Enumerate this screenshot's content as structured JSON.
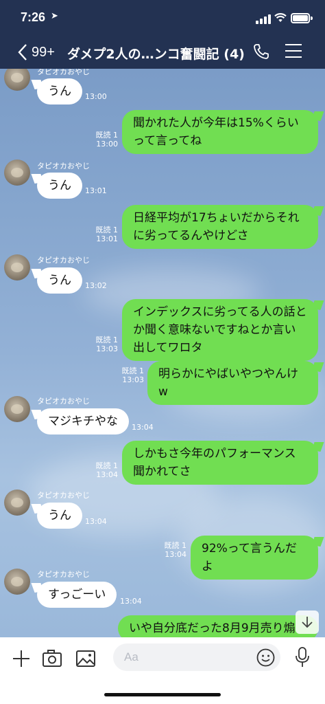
{
  "status": {
    "time": "7:26"
  },
  "header": {
    "back_count": "99+",
    "title": "ダメプ2人の…ンコ奮闘記 (4)"
  },
  "sender_name": "タピオカおやじ",
  "messages": [
    {
      "dir": "in",
      "text": "うん",
      "time": "13:00"
    },
    {
      "dir": "out",
      "text": "聞かれた人が今年は15%くらいって言ってね",
      "read": "既読 1",
      "time": "13:00"
    },
    {
      "dir": "in",
      "text": "うん",
      "time": "13:01"
    },
    {
      "dir": "out",
      "text": "日経平均が17ちょいだからそれに劣ってるんやけどさ",
      "read": "既読 1",
      "time": "13:01"
    },
    {
      "dir": "in",
      "text": "うん",
      "time": "13:02"
    },
    {
      "dir": "out",
      "text": "インデックスに劣ってる人の話とか聞く意味ないですねとか言い出してワロタ",
      "read": "既読 1",
      "time": "13:03"
    },
    {
      "dir": "out",
      "text": "明らかにやばいやつやんけw",
      "read": "既読 1",
      "time": "13:03"
    },
    {
      "dir": "in",
      "text": "マジキチやな",
      "time": "13:04"
    },
    {
      "dir": "out",
      "text": "しかもさ今年のパフォーマンス聞かれてさ",
      "read": "既読 1",
      "time": "13:04"
    },
    {
      "dir": "in",
      "text": "うん",
      "time": "13:04"
    },
    {
      "dir": "out",
      "text": "92%って言うんだよ",
      "read": "既読 1",
      "time": "13:04"
    },
    {
      "dir": "in",
      "text": "すっごーい",
      "time": "13:04"
    },
    {
      "dir": "out",
      "text": "いや自分底だった8月9月売り煽",
      "read": "",
      "time": ""
    }
  ],
  "input": {
    "placeholder": "Aa"
  },
  "icons": {
    "back": "chevron-left-icon",
    "call": "phone-icon",
    "menu": "hamburger-menu-icon",
    "add": "plus-icon",
    "camera": "camera-icon",
    "image": "image-icon",
    "emoji": "smiley-icon",
    "mic": "microphone-icon",
    "scroll": "arrow-down-icon"
  },
  "colors": {
    "header": "#233252",
    "bubble_out": "#71de52",
    "bubble_in": "#ffffff"
  }
}
